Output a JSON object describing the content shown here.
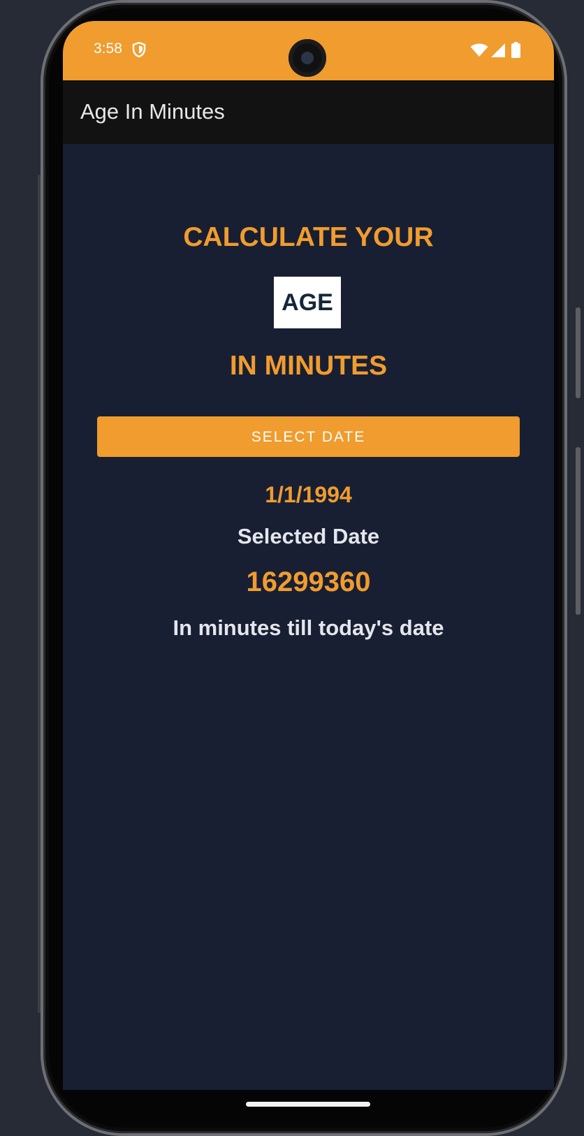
{
  "status_bar": {
    "time": "3:58",
    "icons": [
      "shield-icon",
      "wifi-icon",
      "signal-icon",
      "battery-icon"
    ]
  },
  "app_bar": {
    "title": "Age In Minutes"
  },
  "main": {
    "heading_top": "CALCULATE YOUR",
    "age_badge": "AGE",
    "heading_bottom": "IN MINUTES",
    "select_button_label": "SELECT DATE",
    "selected_date_value": "1/1/1994",
    "selected_date_label": "Selected Date",
    "minutes_value": "16299360",
    "minutes_label": "In minutes till today's date"
  },
  "colors": {
    "accent": "#f09c2e",
    "background": "#181f33",
    "app_bar": "#121212",
    "text_light": "#e4e6ec"
  }
}
